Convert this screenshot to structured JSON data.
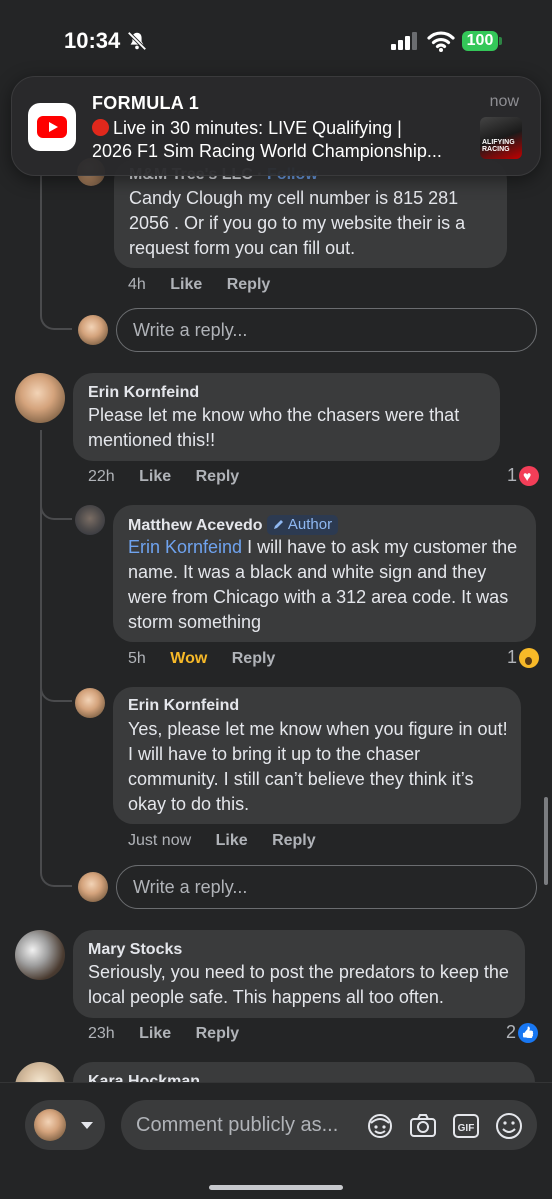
{
  "status_bar": {
    "time": "10:34",
    "battery": "100"
  },
  "notification": {
    "app": "FORMULA 1",
    "time": "now",
    "line1": "Live in 30 minutes: LIVE Qualifying |",
    "line2": "2026 F1 Sim Racing World Championship...",
    "thumb_text": "ALIFYING\nRACING"
  },
  "partial_comment": {
    "name": "M&M Tree's LLC",
    "follow": "Follow",
    "text": "Candy Clough my cell number is 815 281 2056 . Or if you go to my website their is a request form you can fill out.",
    "time": "4h",
    "like": "Like",
    "reply": "Reply"
  },
  "reply_placeholder": "Write a reply...",
  "comments": [
    {
      "name": "Erin Kornfeind",
      "text": "Please let me know who the chasers were that mentioned this!!",
      "time": "22h",
      "like": "Like",
      "reply": "Reply",
      "reaction_count": "1",
      "reaction": "heart",
      "replies": [
        {
          "name": "Matthew Acevedo",
          "badge": "Author",
          "mention": "Erin Kornfeind",
          "text": " I will have to ask my customer the name. It was a black and white sign and they were from Chicago with a 312 area code. It was storm something",
          "time": "5h",
          "like": "Wow",
          "reply": "Reply",
          "reaction_count": "1",
          "reaction": "wow"
        },
        {
          "name": "Erin Kornfeind",
          "text": "Yes, please let me know when you figure in out! I will have to bring it up to the chaser community. I still can’t believe they think it’s okay to do this.",
          "time": "Just now",
          "like": "Like",
          "reply": "Reply"
        }
      ]
    },
    {
      "name": "Mary Stocks",
      "text": "Seriously, you need to post the predators to keep the local people safe. This happens all too often.",
      "time": "23h",
      "like": "Like",
      "reply": "Reply",
      "reaction_count": "2",
      "reaction": "like"
    },
    {
      "name": "Kara Hockman"
    }
  ],
  "composer": {
    "placeholder": "Comment publicly as..."
  },
  "icons": [
    "bell-slash-icon",
    "signal-icon",
    "wifi-icon",
    "youtube-icon",
    "avatar-sticker-icon",
    "camera-icon",
    "gif-icon",
    "emoji-icon"
  ]
}
